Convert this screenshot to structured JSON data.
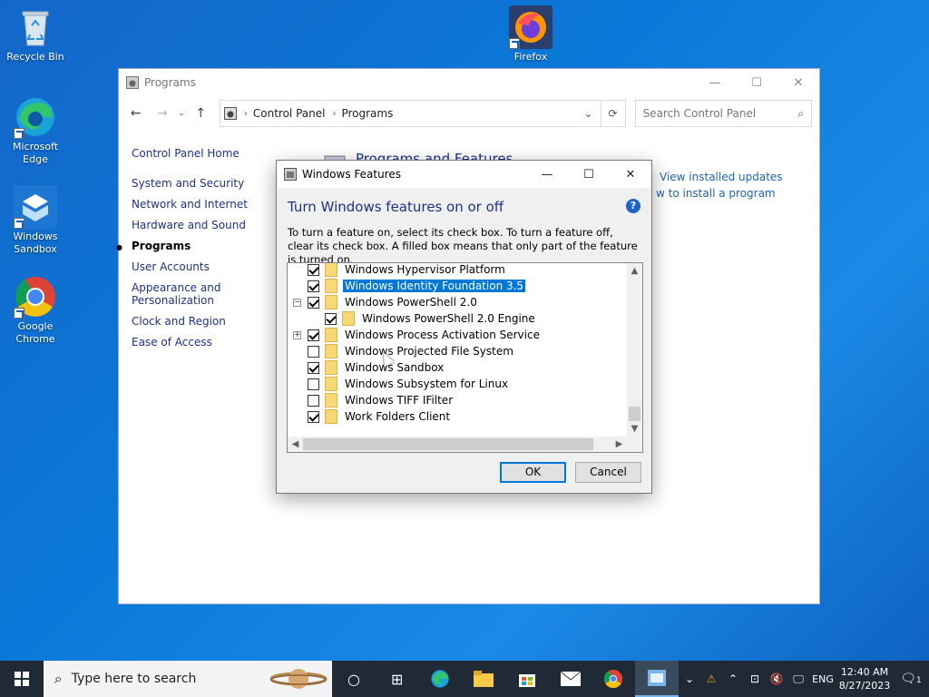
{
  "desktop": {
    "icons": [
      {
        "label": "Recycle Bin"
      },
      {
        "label": "Firefox"
      },
      {
        "label": "Microsoft Edge"
      },
      {
        "label": "Windows Sandbox"
      },
      {
        "label": "Google Chrome"
      }
    ]
  },
  "control_panel": {
    "title": "Programs",
    "breadcrumb": [
      "Control Panel",
      "Programs"
    ],
    "search_placeholder": "Search Control Panel",
    "sidebar": [
      {
        "label": "Control Panel Home"
      },
      {
        "label": "System and Security"
      },
      {
        "label": "Network and Internet"
      },
      {
        "label": "Hardware and Sound"
      },
      {
        "label": "Programs",
        "active": true
      },
      {
        "label": "User Accounts"
      },
      {
        "label": "Appearance and Personalization"
      },
      {
        "label": "Clock and Region"
      },
      {
        "label": "Ease of Access"
      }
    ],
    "main_title": "Programs and Features",
    "main_links": [
      "View installed updates",
      "w to install a program"
    ]
  },
  "features_dialog": {
    "title": "Windows Features",
    "heading": "Turn Windows features on or off",
    "help": "?",
    "description": "To turn a feature on, select its check box. To turn a feature off, clear its check box. A filled box means that only part of the feature is turned on.",
    "features": [
      {
        "label": "Windows Hypervisor Platform",
        "checked": true
      },
      {
        "label": "Windows Identity Foundation 3.5",
        "checked": true,
        "selected": true
      },
      {
        "label": "Windows PowerShell 2.0",
        "checked": true,
        "expander": "−"
      },
      {
        "label": "Windows PowerShell 2.0 Engine",
        "checked": true,
        "child": true
      },
      {
        "label": "Windows Process Activation Service",
        "checked": true,
        "expander": "+"
      },
      {
        "label": "Windows Projected File System",
        "checked": false
      },
      {
        "label": "Windows Sandbox",
        "checked": true
      },
      {
        "label": "Windows Subsystem for Linux",
        "checked": false
      },
      {
        "label": "Windows TIFF IFilter",
        "checked": false
      },
      {
        "label": "Work Folders Client",
        "checked": true
      }
    ],
    "ok_label": "OK",
    "cancel_label": "Cancel"
  },
  "taskbar": {
    "search_placeholder": "Type here to search",
    "language": "ENG",
    "time": "12:40 AM",
    "date": "8/27/2023",
    "notification_count": "1"
  }
}
